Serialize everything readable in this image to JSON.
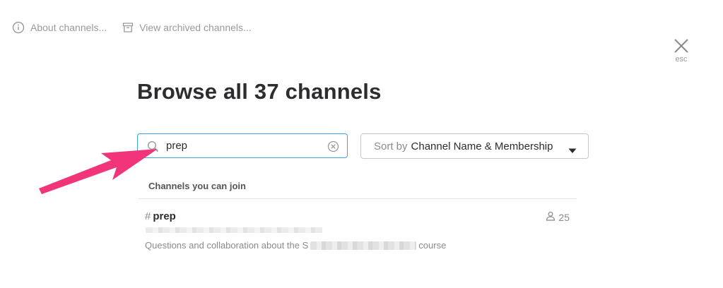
{
  "topbar": {
    "about_label": "About channels...",
    "archived_label": "View archived channels..."
  },
  "close": {
    "esc_label": "esc"
  },
  "title": "Browse all 37 channels",
  "search": {
    "value": "prep"
  },
  "sort": {
    "prefix": "Sort by",
    "value": "Channel Name & Membership"
  },
  "section_heading": "Channels you can join",
  "channels": [
    {
      "hash": "#",
      "name": "prep",
      "member_count": "25",
      "purpose_start": "Questions and collaboration about the S",
      "purpose_end": "course"
    }
  ],
  "colors": {
    "accent_border": "#3aa3e3",
    "annotation_arrow": "#f2357a"
  },
  "icons": [
    "info-icon",
    "archive-icon",
    "close-icon",
    "search-icon",
    "clear-icon",
    "caret-down-icon",
    "member-icon",
    "annotation-arrow"
  ]
}
